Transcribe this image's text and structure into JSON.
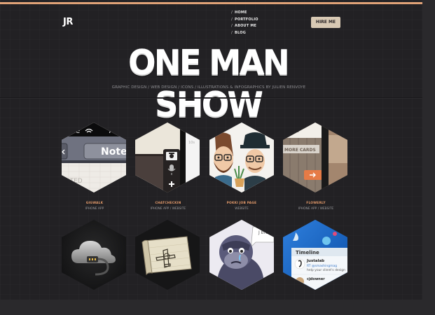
{
  "header": {
    "logo": "JR",
    "nav": [
      "HOME",
      "PORTFOLIO",
      "ABOUT ME",
      "BLOG"
    ],
    "hire_button": "HIRE ME"
  },
  "hero": {
    "title": "ONE MAN SHOW",
    "subtitle": "GRAPHIC DESIGN / WEB DESIGN / ICONS / ILLUSTRATIONS & INFOGRAPHICS BY JULIEN RENVOYE"
  },
  "portfolio": {
    "row1": [
      {
        "title": "GIGWALK",
        "subtitle": "IPHONE APP"
      },
      {
        "title": "CHATCHECKIN",
        "subtitle": "IPHONE APP / WEBSITE"
      },
      {
        "title": "POKKI JOB PAGE",
        "subtitle": "WEBSITE"
      },
      {
        "title": "FLOWERLY",
        "subtitle": "IPHONE APP / WEBSITE"
      }
    ],
    "thumb_text": {
      "gigwalk_carrier": "obile",
      "gigwalk_time": "7:5",
      "gigwalk_note": "Note",
      "gigwalk_stamp": "DITED",
      "chat_text": "10s",
      "flowerly_top": "and",
      "flowerly_more": "MORE CARDS",
      "gorilla_bubble": "J\nbreak",
      "twitter_header": "Timeline",
      "twitter_user": "Justalab",
      "twitter_rt": "RT @smashingmag",
      "twitter_body": "help your client's design",
      "twitter_user2": "cjdowner"
    }
  },
  "colors": {
    "accent": "#e0a277",
    "hire_bg": "#d8c9b4",
    "label_orange": "#e39a6a",
    "background": "#222124"
  }
}
